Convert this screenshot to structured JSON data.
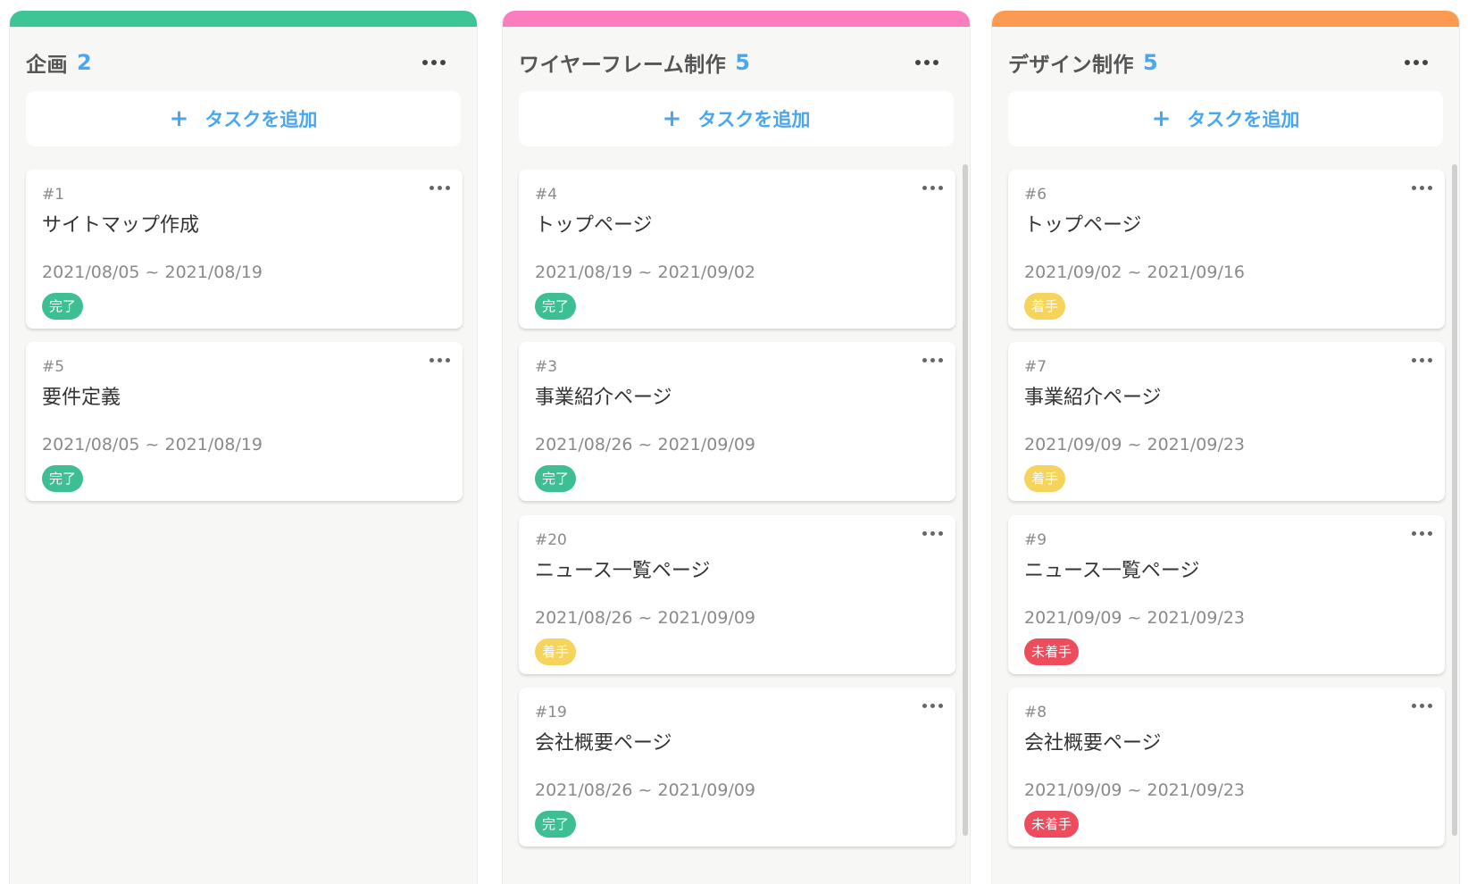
{
  "add_task_label": "タスクを追加",
  "columns": [
    {
      "title": "企画",
      "count": "2",
      "color": "#3ec596",
      "cards": [
        {
          "id": "#1",
          "title": "サイトマップ作成",
          "date": "2021/08/05 ~ 2021/08/19",
          "status": "完了",
          "status_type": "done"
        },
        {
          "id": "#5",
          "title": "要件定義",
          "date": "2021/08/05 ~ 2021/08/19",
          "status": "完了",
          "status_type": "done"
        }
      ]
    },
    {
      "title": "ワイヤーフレーム制作",
      "count": "5",
      "color": "#fb7dbf",
      "cards": [
        {
          "id": "#4",
          "title": "トップページ",
          "date": "2021/08/19 ~ 2021/09/02",
          "status": "完了",
          "status_type": "done"
        },
        {
          "id": "#3",
          "title": "事業紹介ページ",
          "date": "2021/08/26 ~ 2021/09/09",
          "status": "完了",
          "status_type": "done"
        },
        {
          "id": "#20",
          "title": "ニュース一覧ページ",
          "date": "2021/08/26 ~ 2021/09/09",
          "status": "着手",
          "status_type": "started"
        },
        {
          "id": "#19",
          "title": "会社概要ページ",
          "date": "2021/08/26 ~ 2021/09/09",
          "status": "完了",
          "status_type": "done"
        }
      ]
    },
    {
      "title": "デザイン制作",
      "count": "5",
      "color": "#fd9a52",
      "cards": [
        {
          "id": "#6",
          "title": "トップページ",
          "date": "2021/09/02 ~ 2021/09/16",
          "status": "着手",
          "status_type": "started"
        },
        {
          "id": "#7",
          "title": "事業紹介ページ",
          "date": "2021/09/09 ~ 2021/09/23",
          "status": "着手",
          "status_type": "started"
        },
        {
          "id": "#9",
          "title": "ニュース一覧ページ",
          "date": "2021/09/09 ~ 2021/09/23",
          "status": "未着手",
          "status_type": "notstarted"
        },
        {
          "id": "#8",
          "title": "会社概要ページ",
          "date": "2021/09/09 ~ 2021/09/23",
          "status": "未着手",
          "status_type": "notstarted"
        }
      ]
    }
  ]
}
